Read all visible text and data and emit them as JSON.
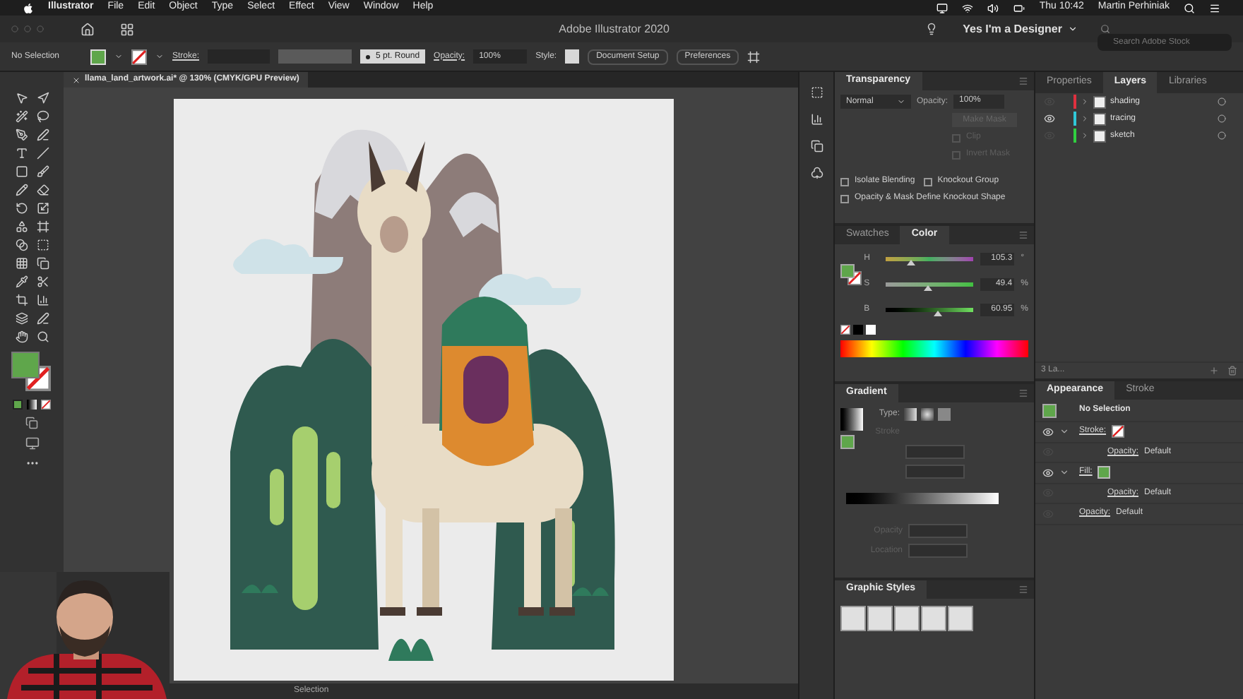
{
  "menu_bar": {
    "app": "Illustrator",
    "items": [
      "File",
      "Edit",
      "Object",
      "Type",
      "Select",
      "Effect",
      "View",
      "Window",
      "Help"
    ],
    "clock": "Thu 10:42",
    "user": "Martin Perhiniak"
  },
  "title_bar": {
    "title": "Adobe Illustrator 2020",
    "workspace": "Yes I'm a Designer",
    "search": {
      "placeholder": "Search Adobe Stock"
    }
  },
  "control_bar": {
    "selection": "No Selection",
    "stroke_label": "Stroke:",
    "brush": "5 pt. Round",
    "opacity_label": "Opacity:",
    "opacity": "100%",
    "style_label": "Style:",
    "buttons": [
      "Document Setup",
      "Preferences"
    ]
  },
  "document": {
    "tab": "llama_land_artwork.ai* @ 130% (CMYK/GPU Preview)",
    "status": "Selection"
  },
  "transparency": {
    "title": "Transparency",
    "blend_mode": "Normal",
    "opacity_label": "Opacity:",
    "opacity": "100%",
    "make_mask": "Make Mask",
    "mask_options": [
      {
        "label": "Clip",
        "checked": false
      },
      {
        "label": "Invert Mask",
        "checked": false
      }
    ],
    "options": [
      {
        "label": "Isolate Blending",
        "checked": false
      },
      {
        "label": "Knockout Group",
        "checked": false
      },
      {
        "label": "Opacity & Mask Define Knockout Shape",
        "checked": false
      }
    ]
  },
  "layers_panel": {
    "tabs": [
      {
        "label": "Properties",
        "selected": false
      },
      {
        "label": "Layers",
        "selected": true
      },
      {
        "label": "Libraries",
        "selected": false
      }
    ],
    "layers": [
      {
        "name": "shading",
        "color": "#e0303f",
        "visible": false
      },
      {
        "name": "tracing",
        "color": "#30c8d8",
        "visible": true
      },
      {
        "name": "sketch",
        "color": "#30d040",
        "visible": false
      }
    ],
    "footer": "3 La..."
  },
  "color_panel": {
    "tabs": [
      {
        "label": "Swatches",
        "selected": false
      },
      {
        "label": "Color",
        "selected": true
      }
    ],
    "sliders": [
      {
        "kind": "hue",
        "label": "H",
        "level": 0.29,
        "value": "105.3",
        "unit": "°"
      },
      {
        "kind": "saturation",
        "label": "S",
        "level": 0.494,
        "value": "49.4",
        "unit": "%"
      },
      {
        "kind": "brightness",
        "label": "B",
        "level": 0.61,
        "value": "60.95",
        "unit": "%"
      }
    ]
  },
  "gradient_panel": {
    "title": "Gradient",
    "type_label": "Type:",
    "stroke_label": "Stroke",
    "opacity_label": "Opacity",
    "location_label": "Location"
  },
  "graphic_styles": {
    "title": "Graphic Styles"
  },
  "appearance_panel": {
    "tabs": [
      {
        "label": "Appearance",
        "selected": true
      },
      {
        "label": "Stroke",
        "selected": false
      }
    ],
    "target": "No Selection",
    "rows": [
      {
        "kind": "stroke",
        "label": "Stroke:",
        "visible": true,
        "children": [
          {
            "kind": "attribute",
            "label": "Opacity:",
            "value": "Default",
            "visible": false
          }
        ]
      },
      {
        "kind": "fill",
        "label": "Fill:",
        "visible": true,
        "children": [
          {
            "kind": "attribute",
            "label": "Opacity:",
            "value": "Default",
            "visible": false
          }
        ]
      },
      {
        "kind": "attribute",
        "label": "Opacity:",
        "value": "Default",
        "visible": false
      }
    ]
  }
}
